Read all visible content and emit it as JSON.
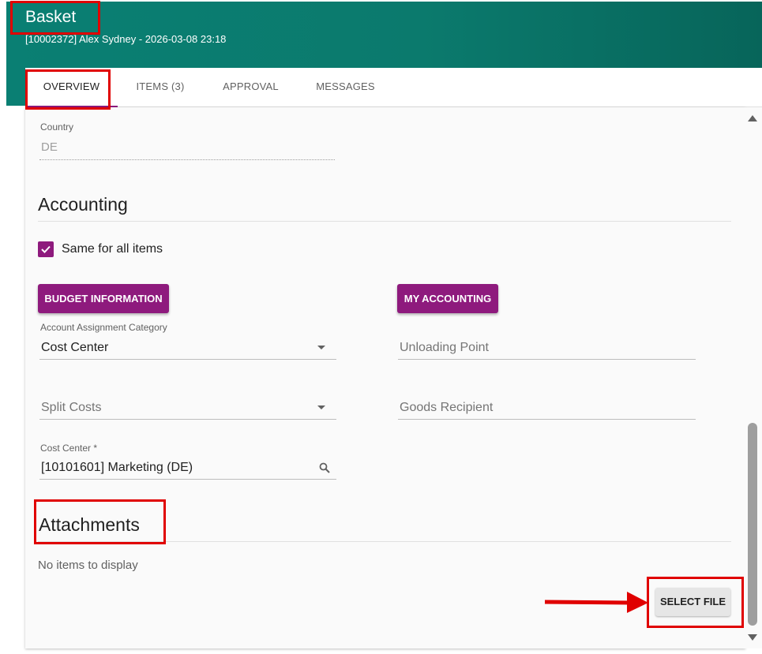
{
  "header": {
    "title": "Basket",
    "subtitle": "[10002372] Alex Sydney - 2026-03-08 23:18"
  },
  "tabs": [
    {
      "label": "OVERVIEW",
      "active": true
    },
    {
      "label": "ITEMS (3)",
      "active": false
    },
    {
      "label": "APPROVAL",
      "active": false
    },
    {
      "label": "MESSAGES",
      "active": false
    }
  ],
  "country": {
    "label": "Country",
    "value": "DE"
  },
  "accounting": {
    "title": "Accounting",
    "same_for_all": {
      "label": "Same for all items",
      "checked": true
    },
    "budget_button": "BUDGET INFORMATION",
    "my_accounting_button": "MY ACCOUNTING",
    "assignment_category": {
      "label": "Account Assignment Category",
      "value": "Cost Center"
    },
    "unloading_point": {
      "placeholder": "Unloading Point"
    },
    "split_costs": {
      "placeholder": "Split Costs"
    },
    "goods_recipient": {
      "placeholder": "Goods Recipient"
    },
    "cost_center": {
      "label": "Cost Center *",
      "value": "[10101601] Marketing (DE)"
    }
  },
  "attachments": {
    "title": "Attachments",
    "empty_text": "No items to display",
    "select_file_button": "SELECT FILE"
  },
  "colors": {
    "header_teal": "#0a7f73",
    "accent_purple": "#8e1a7d",
    "highlight_red": "#e00000"
  }
}
